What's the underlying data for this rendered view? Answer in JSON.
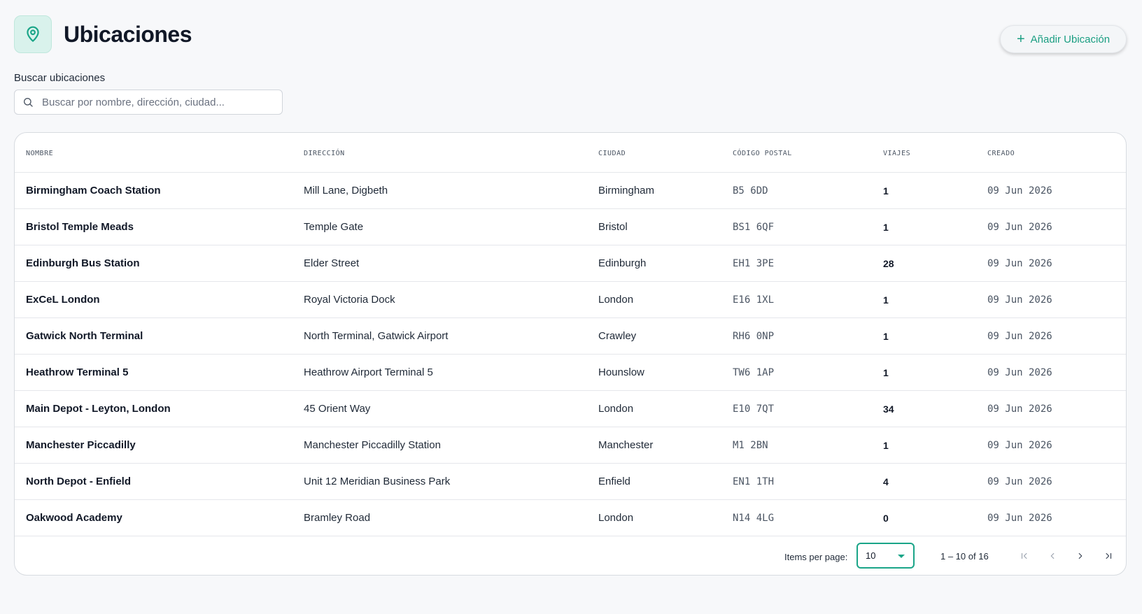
{
  "header": {
    "title": "Ubicaciones",
    "add_button_label": "Añadir Ubicación"
  },
  "search": {
    "label": "Buscar ubicaciones",
    "placeholder": "Buscar por nombre, dirección, ciudad..."
  },
  "table": {
    "columns": {
      "name": "NOMBRE",
      "address": "DIRECCIÓN",
      "city": "CIUDAD",
      "postcode": "CÓDIGO POSTAL",
      "trips": "VIAJES",
      "created": "CREADO"
    },
    "rows": [
      {
        "name": "Birmingham Coach Station",
        "address": "Mill Lane, Digbeth",
        "city": "Birmingham",
        "postcode": "B5 6DD",
        "trips": "1",
        "created": "09 Jun 2026"
      },
      {
        "name": "Bristol Temple Meads",
        "address": "Temple Gate",
        "city": "Bristol",
        "postcode": "BS1 6QF",
        "trips": "1",
        "created": "09 Jun 2026"
      },
      {
        "name": "Edinburgh Bus Station",
        "address": "Elder Street",
        "city": "Edinburgh",
        "postcode": "EH1 3PE",
        "trips": "28",
        "created": "09 Jun 2026"
      },
      {
        "name": "ExCeL London",
        "address": "Royal Victoria Dock",
        "city": "London",
        "postcode": "E16 1XL",
        "trips": "1",
        "created": "09 Jun 2026"
      },
      {
        "name": "Gatwick North Terminal",
        "address": "North Terminal, Gatwick Airport",
        "city": "Crawley",
        "postcode": "RH6 0NP",
        "trips": "1",
        "created": "09 Jun 2026"
      },
      {
        "name": "Heathrow Terminal 5",
        "address": "Heathrow Airport Terminal 5",
        "city": "Hounslow",
        "postcode": "TW6 1AP",
        "trips": "1",
        "created": "09 Jun 2026"
      },
      {
        "name": "Main Depot - Leyton, London",
        "address": "45 Orient Way",
        "city": "London",
        "postcode": "E10 7QT",
        "trips": "34",
        "created": "09 Jun 2026"
      },
      {
        "name": "Manchester Piccadilly",
        "address": "Manchester Piccadilly Station",
        "city": "Manchester",
        "postcode": "M1 2BN",
        "trips": "1",
        "created": "09 Jun 2026"
      },
      {
        "name": "North Depot - Enfield",
        "address": "Unit 12 Meridian Business Park",
        "city": "Enfield",
        "postcode": "EN1 1TH",
        "trips": "4",
        "created": "09 Jun 2026"
      },
      {
        "name": "Oakwood Academy",
        "address": "Bramley Road",
        "city": "London",
        "postcode": "N14 4LG",
        "trips": "0",
        "created": "09 Jun 2026"
      }
    ]
  },
  "paginator": {
    "items_per_page_label": "Items per page:",
    "page_size": "10",
    "range_label": "1 – 10 of 16"
  },
  "colors": {
    "accent": "#1aa588",
    "accent_bg": "#d9f2ec"
  },
  "icons": {
    "logo": "map-pin-icon",
    "search": "search-icon",
    "add": "plus-icon"
  }
}
